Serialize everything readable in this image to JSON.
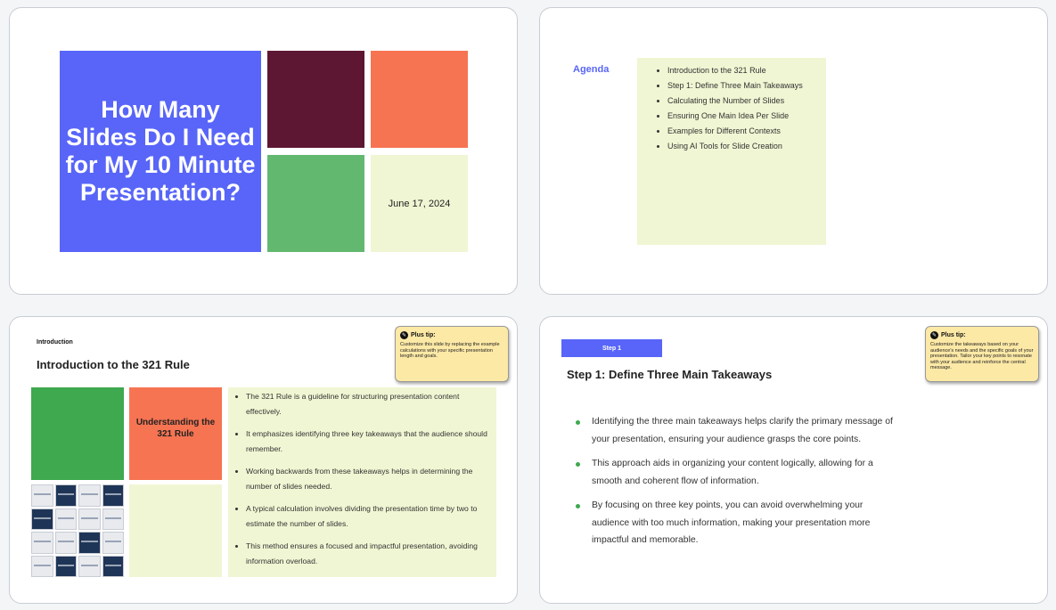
{
  "slide1": {
    "title": "How Many Slides Do I Need for My 10 Minute Presentation?",
    "date": "June 17, 2024",
    "colors": {
      "blue": "#5865f8",
      "maroon": "#5e1733",
      "coral": "#f67452",
      "green": "#63b870",
      "cream": "#f0f6d3"
    }
  },
  "slide2": {
    "agenda_title": "Agenda",
    "items": [
      "Introduction to the 321 Rule",
      "Step 1: Define Three Main Takeaways",
      "Calculating the Number of Slides",
      "Ensuring One Main Idea Per Slide",
      "Examples for Different Contexts",
      "Using AI Tools for Slide Creation"
    ]
  },
  "slide3": {
    "section_label": "Introduction",
    "heading": "Introduction to the 321 Rule",
    "tip_title": "Plus tip:",
    "tip_body": "Customize this slide by replacing the example calculations with your specific presentation length and goals.",
    "card_label": "Understanding the 321 Rule",
    "bullets": [
      "The 321 Rule is a guideline for structuring presentation content effectively.",
      "It emphasizes identifying three key takeaways that the audience should remember.",
      "Working backwards from these takeaways helps in determining the number of slides needed.",
      "A typical calculation involves dividing the presentation time by two to estimate the number of slides.",
      "This method ensures a focused and impactful presentation, avoiding information overload."
    ]
  },
  "slide4": {
    "step_tag": "Step 1",
    "heading": "Step 1: Define Three Main Takeaways",
    "tip_title": "Plus tip:",
    "tip_body": "Customize the takeaways based on your audience's needs and the specific goals of your presentation. Tailor your key points to resonate with your audience and reinforce the central message.",
    "bullets": [
      "Identifying the three main takeaways helps clarify the primary message of your presentation, ensuring your audience grasps the core points.",
      "This approach aids in organizing your content logically, allowing for a smooth and coherent flow of information.",
      "By focusing on three key points, you can avoid overwhelming your audience with too much information, making your presentation more impactful and memorable."
    ]
  }
}
